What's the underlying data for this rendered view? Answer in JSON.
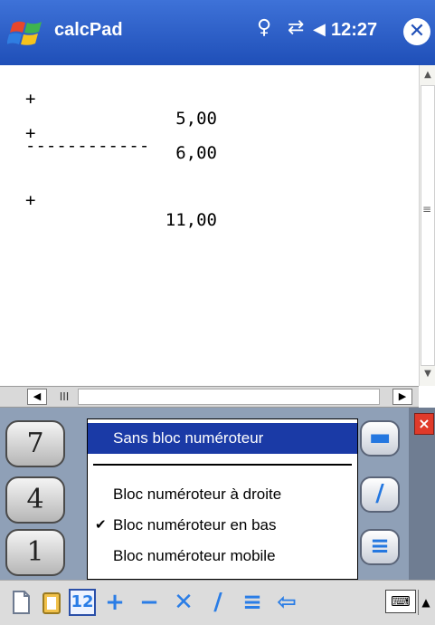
{
  "titlebar": {
    "app_title": "calcPad",
    "clock": "12:27",
    "close_glyph": "✕"
  },
  "document": {
    "lines": [
      {
        "op": "+",
        "value": "5,00"
      },
      {
        "op": "+",
        "value": "6,00"
      },
      {
        "separator": "------------"
      },
      {
        "op": "+",
        "value": "11,00"
      }
    ]
  },
  "hscrollbar": {
    "left_glyph": "◀",
    "right_glyph": "▶",
    "thumb_glyph": "III"
  },
  "keypad": {
    "keys": [
      {
        "label": "7"
      },
      {
        "label": "4"
      },
      {
        "label": "1"
      }
    ],
    "close_glyph": "×"
  },
  "menu": {
    "items": [
      {
        "label": "Sans bloc numéroteur",
        "selected": true,
        "checked": false
      },
      {
        "label": "Bloc numéroteur à droite",
        "selected": false,
        "checked": false
      },
      {
        "label": "Bloc numéroteur en bas",
        "selected": false,
        "checked": true
      },
      {
        "label": "Bloc numéroteur mobile",
        "selected": false,
        "checked": false
      }
    ],
    "check_glyph": "✔"
  },
  "toolbar": {
    "buttons": [
      {
        "icon": "new-document-icon"
      },
      {
        "icon": "clipboard-icon"
      },
      {
        "icon": "keypad-toggle-icon",
        "label": "12"
      },
      {
        "icon": "plus-icon",
        "label": "+"
      },
      {
        "icon": "minus-icon",
        "label": "−"
      },
      {
        "icon": "multiply-icon",
        "label": "✕"
      },
      {
        "icon": "divide-icon",
        "label": "/"
      },
      {
        "icon": "equals-icon",
        "label": "≡"
      },
      {
        "icon": "backspace-icon",
        "label": "⇦"
      }
    ]
  },
  "colors": {
    "title_bar": "#1f4fb8",
    "menu_selected": "#1a3aa6",
    "keypad_bg": "#8fa0b7",
    "accent_blue": "#2a7de6"
  }
}
